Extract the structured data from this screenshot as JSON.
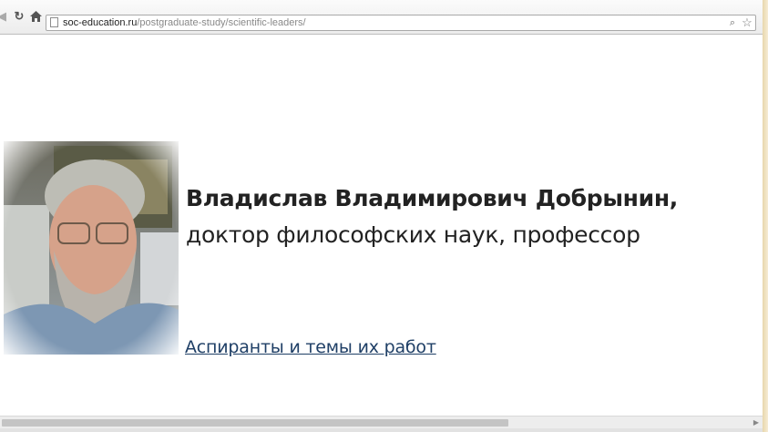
{
  "browser": {
    "url_host": "soc-education.ru",
    "url_path": "/postgraduate-study/scientific-leaders/"
  },
  "icons": {
    "back": "back-arrow-icon",
    "reload": "reload-icon",
    "home": "home-icon",
    "page": "page-icon",
    "zoom": "zoom-icon",
    "bookmark": "star-icon"
  },
  "profile": {
    "name": "Владислав Владимирович Добрынин,",
    "title": "доктор философских наук, профессор",
    "link": "Аспиранты и темы их работ"
  },
  "colors": {
    "link": "#1f3f66",
    "text": "#222222",
    "frame": "#f3e7cc"
  }
}
